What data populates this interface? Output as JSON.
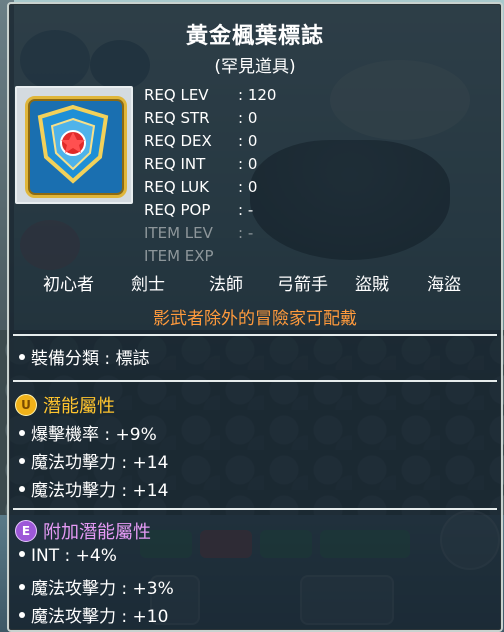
{
  "item": {
    "name": "黃金楓葉標誌",
    "rarity": "(罕見道具)",
    "icon": "golden-maple-emblem-icon"
  },
  "requirements": [
    {
      "label": "REQ LEV",
      "sep": ":",
      "value": "120"
    },
    {
      "label": "REQ STR",
      "sep": ":",
      "value": "0"
    },
    {
      "label": "REQ DEX",
      "sep": ":",
      "value": "0"
    },
    {
      "label": "REQ INT",
      "sep": ":",
      "value": "0"
    },
    {
      "label": "REQ LUK",
      "sep": ":",
      "value": "0"
    },
    {
      "label": "REQ POP",
      "sep": ":",
      "value": "-"
    },
    {
      "label": "ITEM LEV",
      "sep": ":",
      "value": "-"
    },
    {
      "label": "ITEM EXP",
      "sep": "",
      "value": ""
    }
  ],
  "jobs": [
    "初心者",
    "劍士",
    "法師",
    "弓箭手",
    "盜賊",
    "海盜"
  ],
  "notice": "影武者除外的冒險家可配戴",
  "category": "裝備分類 : 標誌",
  "potential": {
    "title": "潛能屬性",
    "badge": "U",
    "lines": [
      "爆擊機率 : +9%",
      "魔法功擊力 : +14",
      "魔法功擊力 : +14"
    ]
  },
  "bonus_potential": {
    "title": "附加潛能屬性",
    "badge": "E",
    "lines": [
      "INT : +4%",
      "魔法攻擊力 : +3%",
      "魔法攻擊力 : +10"
    ]
  },
  "colors": {
    "notice": "#ff9a3c",
    "potential_title": "#ffc42e",
    "bonus_title": "#e59af5",
    "dim_req": "#8d969a"
  }
}
